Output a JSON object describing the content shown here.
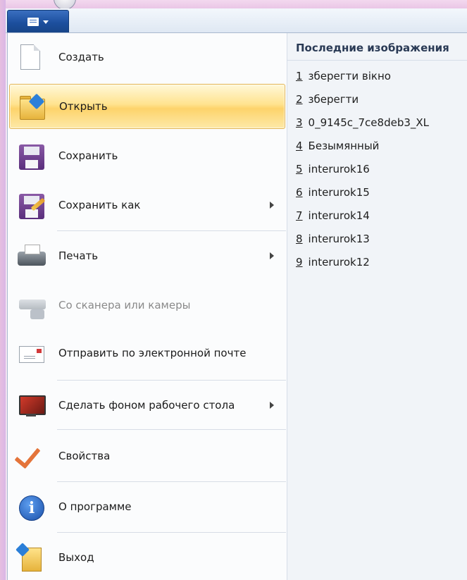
{
  "menu": {
    "items": [
      {
        "label": "Создать",
        "icon": "new-document-icon",
        "submenu": false
      },
      {
        "label": "Открыть",
        "icon": "open-folder-icon",
        "submenu": false,
        "highlighted": true
      },
      {
        "label": "Сохранить",
        "icon": "save-floppy-icon",
        "submenu": false
      },
      {
        "label": "Сохранить как",
        "icon": "save-as-icon",
        "submenu": true
      },
      {
        "label": "Печать",
        "icon": "printer-icon",
        "submenu": true
      },
      {
        "label": "Со сканера или камеры",
        "icon": "scanner-camera-icon",
        "submenu": false,
        "disabled": true
      },
      {
        "label": "Отправить по электронной почте",
        "icon": "email-icon",
        "submenu": false
      },
      {
        "label": "Сделать фоном рабочего стола",
        "icon": "desktop-background-icon",
        "submenu": true
      },
      {
        "label": "Свойства",
        "icon": "properties-check-icon",
        "submenu": false
      },
      {
        "label": "О программе",
        "icon": "info-icon",
        "submenu": false
      },
      {
        "label": "Выход",
        "icon": "exit-icon",
        "submenu": false
      }
    ]
  },
  "recent": {
    "title": "Последние изображения",
    "items": [
      {
        "num": "1",
        "name": "зберегти вікно"
      },
      {
        "num": "2",
        "name": "зберегти"
      },
      {
        "num": "3",
        "name": "0_9145c_7ce8deb3_XL"
      },
      {
        "num": "4",
        "name": "Безымянный"
      },
      {
        "num": "5",
        "name": "interurok16"
      },
      {
        "num": "6",
        "name": "interurok15"
      },
      {
        "num": "7",
        "name": "interurok14"
      },
      {
        "num": "8",
        "name": "interurok13"
      },
      {
        "num": "9",
        "name": "interurok12"
      }
    ]
  },
  "colors": {
    "app_button": "#1c4f9e",
    "highlight": "#ffe38f",
    "accent_check": "#e4743a"
  }
}
